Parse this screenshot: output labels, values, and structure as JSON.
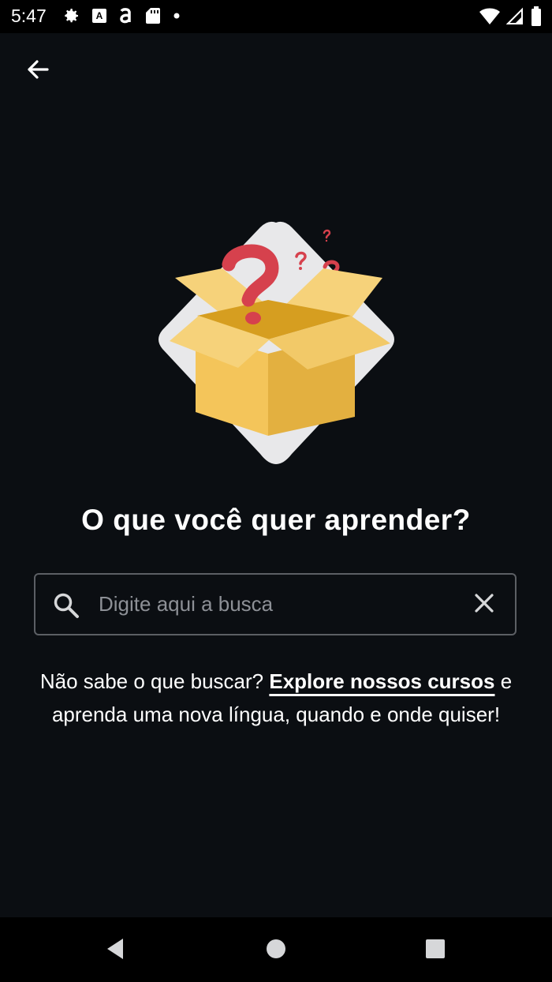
{
  "status_bar": {
    "time": "5:47",
    "left_icons": [
      "gear-icon",
      "font-badge-icon",
      "app-a-icon",
      "sd-card-icon",
      "dot-icon"
    ],
    "right_icons": [
      "wifi-icon",
      "cellular-signal-icon",
      "battery-icon"
    ]
  },
  "header": {
    "back_icon": "arrow-left-icon"
  },
  "illustration": {
    "name": "open-box-with-question-marks",
    "colors": {
      "box_front": "#f4c55a",
      "box_side": "#e3b040",
      "box_inside": "#d69e20",
      "flaps": "#f6d27a",
      "question": "#d6414d",
      "diamond": "#e8e8ea"
    }
  },
  "main": {
    "title": "O que você quer aprender?",
    "search": {
      "placeholder": "Digite aqui a busca",
      "value": ""
    },
    "help": {
      "before": "Não sabe o que buscar? ",
      "link": "Explore nossos cursos",
      "after": " e aprenda uma nova língua, quando e onde quiser!"
    }
  },
  "nav_bar": {
    "icons": [
      "back-triangle-icon",
      "home-circle-icon",
      "recents-square-icon"
    ]
  },
  "colors": {
    "background": "#0b0e12",
    "text": "#ffffff",
    "border": "#5c5f64",
    "placeholder": "#8d9096"
  }
}
